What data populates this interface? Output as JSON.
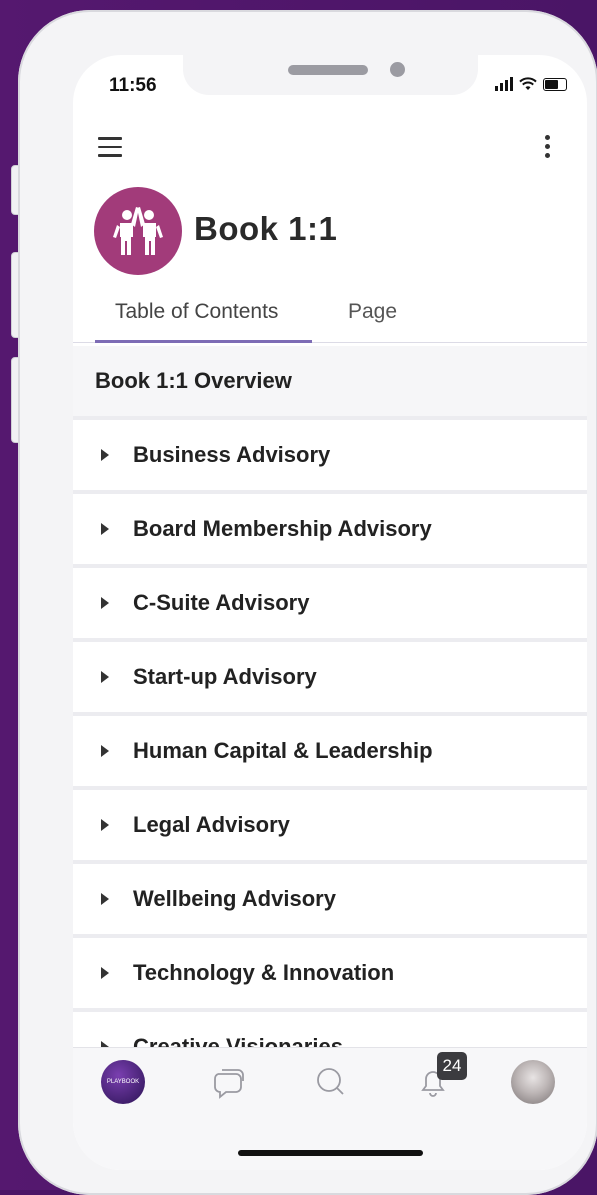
{
  "status_bar": {
    "time": "11:56"
  },
  "header": {
    "title": "Book 1:1"
  },
  "tabs": [
    {
      "label": "Table of Contents",
      "selected": true
    },
    {
      "label": "Page",
      "selected": false
    }
  ],
  "list": {
    "overview": "Book 1:1 Overview",
    "items": [
      {
        "label": "Business Advisory"
      },
      {
        "label": "Board Membership Advisory"
      },
      {
        "label": "C-Suite Advisory"
      },
      {
        "label": "Start-up Advisory"
      },
      {
        "label": "Human Capital & Leadership"
      },
      {
        "label": "Legal Advisory"
      },
      {
        "label": "Wellbeing Advisory"
      },
      {
        "label": "Technology & Innovation"
      },
      {
        "label": "Creative Visionaries"
      }
    ]
  },
  "tab_bar": {
    "playbook_logo_text": "PLAYBOOK",
    "notifications_count": "24"
  },
  "colors": {
    "background": "#4a1566",
    "brand_logo": "#a23b7a",
    "tab_underline": "#7d6cb5"
  },
  "icons": [
    "hamburger-menu-icon",
    "more-vertical-icon",
    "high-five-icon",
    "caret-right-icon",
    "chat-icon",
    "search-icon",
    "bell-icon"
  ]
}
